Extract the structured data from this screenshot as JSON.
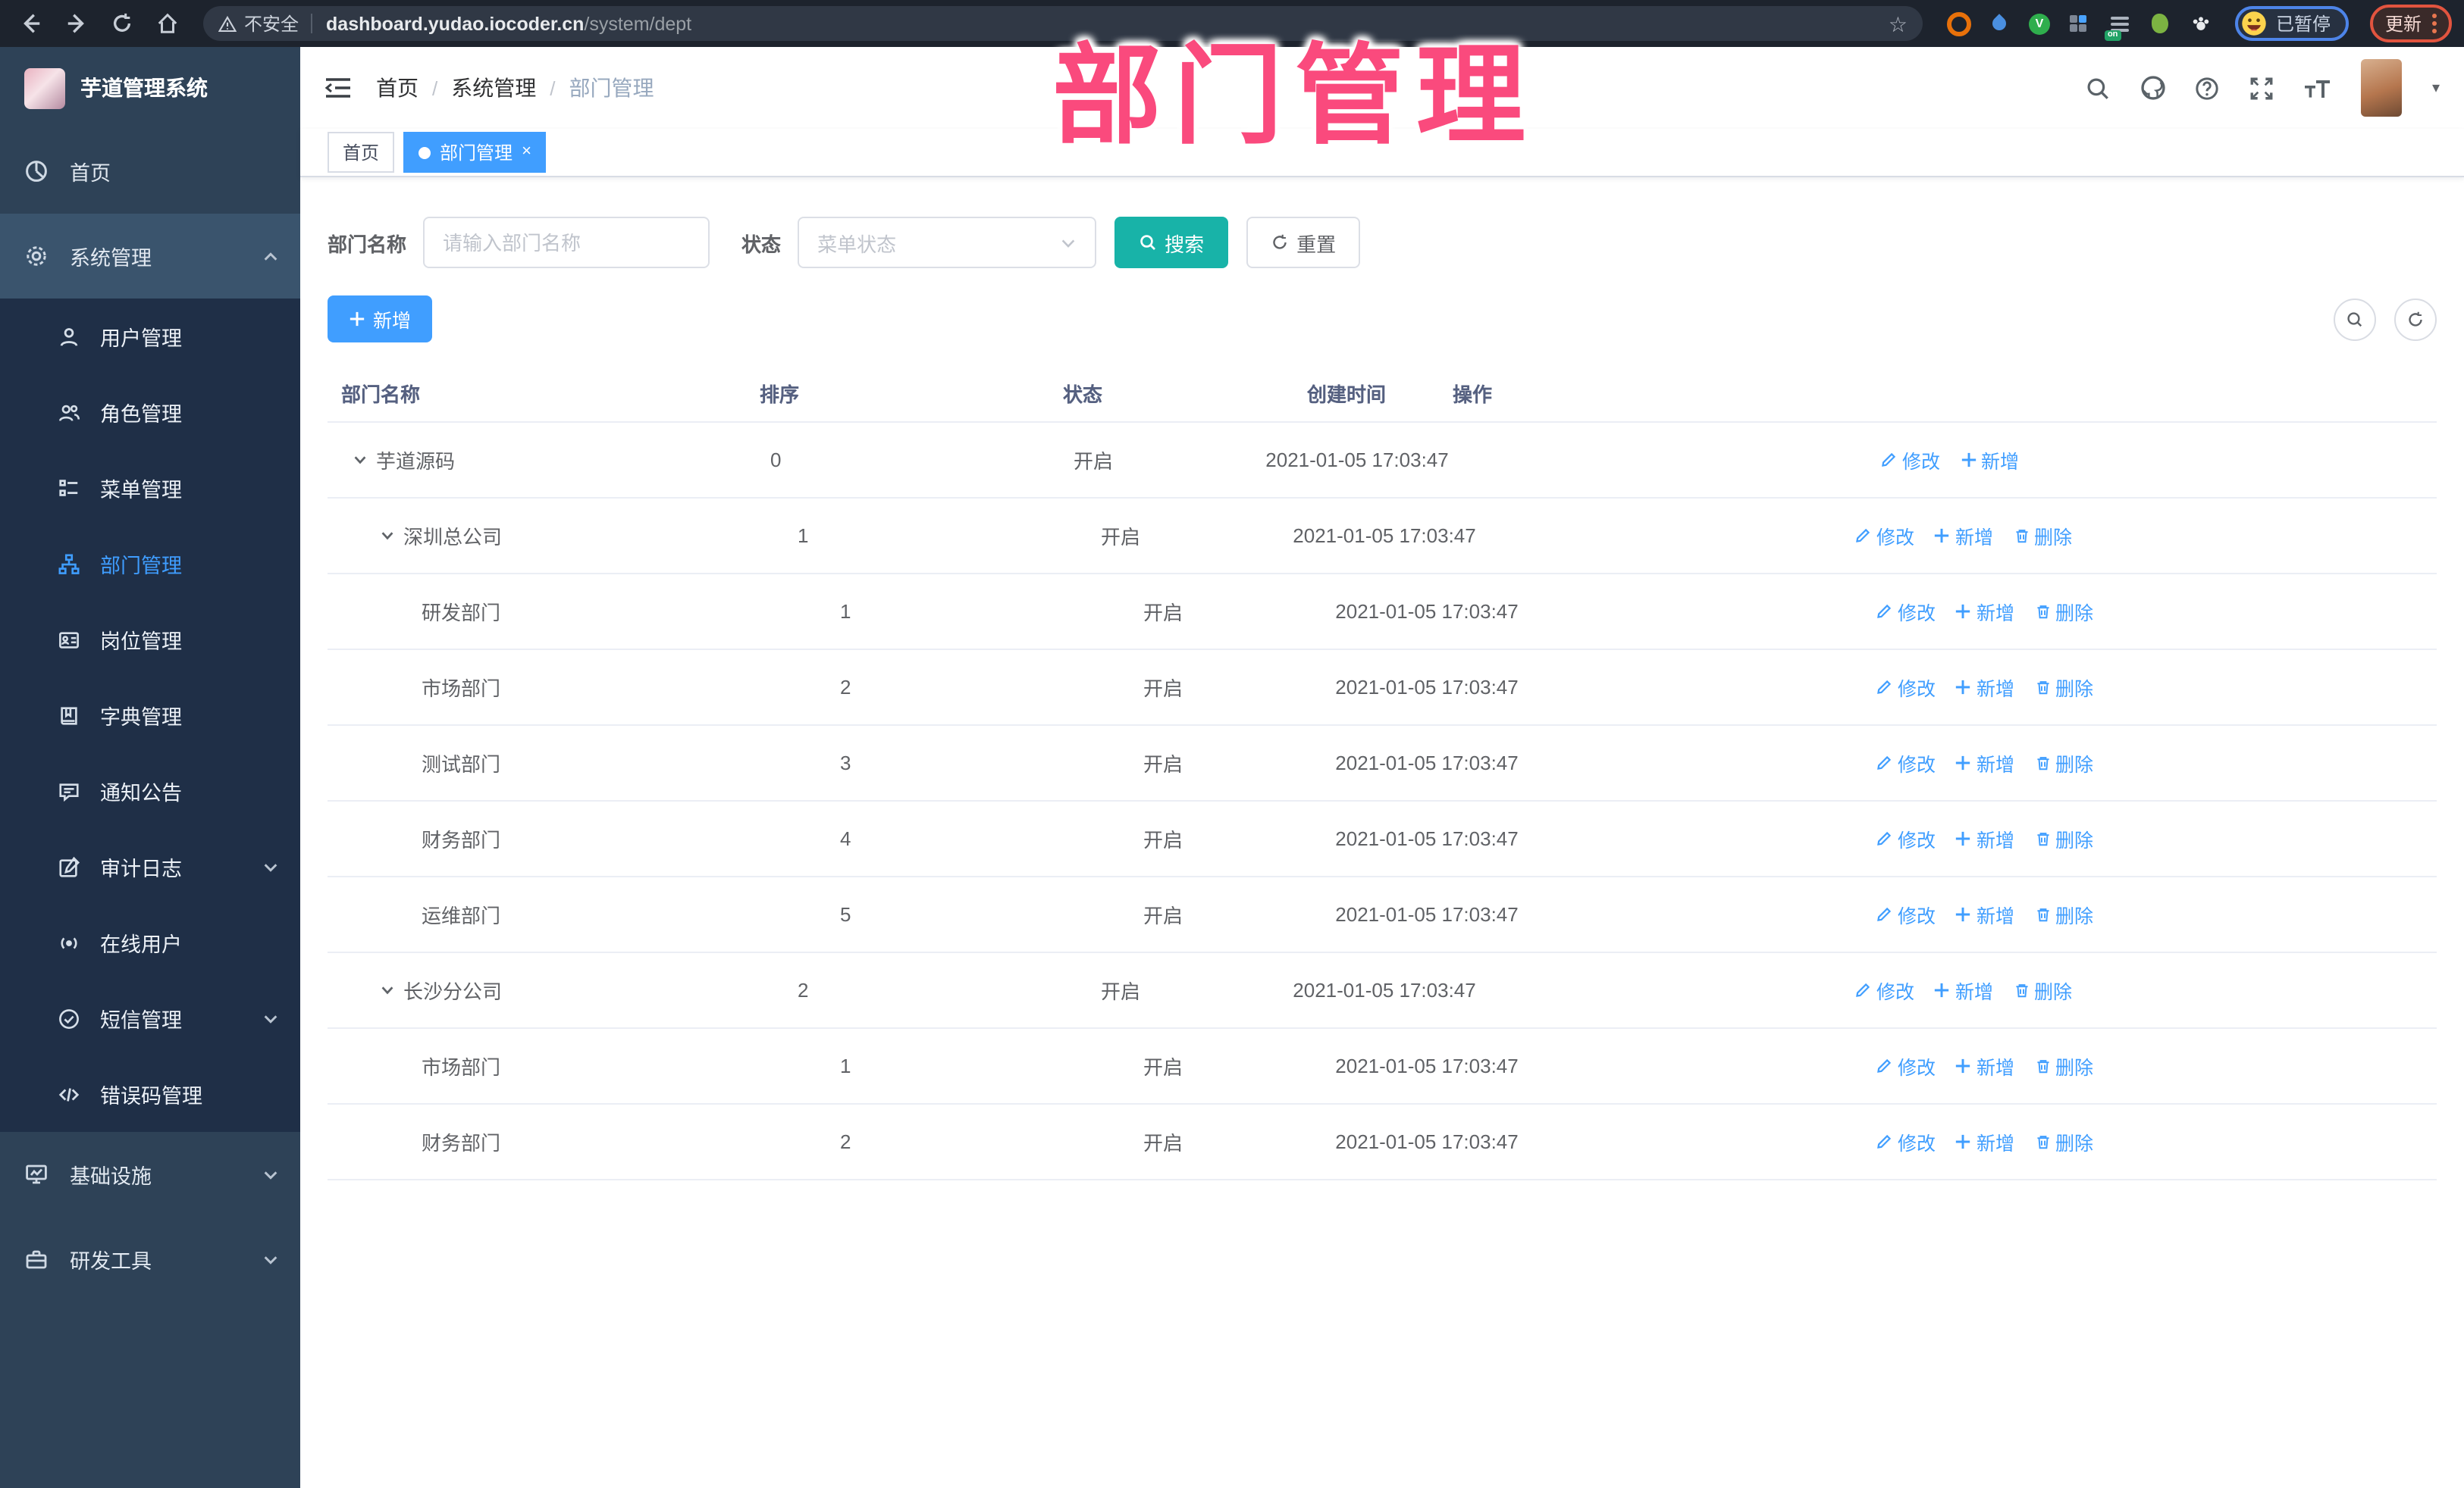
{
  "overlay_title": "部门管理",
  "browser": {
    "security_label": "不安全",
    "url_domain": "dashboard.yudao.iocoder.cn",
    "url_path": "/system/dept",
    "extension_badge": "on",
    "extension_v": "V",
    "profile_status": "已暂停",
    "update_label": "更新"
  },
  "sidebar": {
    "app_title": "芋道管理系统",
    "home": "首页",
    "system": "系统管理",
    "sub": [
      "用户管理",
      "角色管理",
      "菜单管理",
      "部门管理",
      "岗位管理",
      "字典管理",
      "通知公告",
      "审计日志",
      "在线用户",
      "短信管理",
      "错误码管理"
    ],
    "infra": "基础设施",
    "devtools": "研发工具"
  },
  "navbar": {
    "breadcrumb": [
      "首页",
      "系统管理",
      "部门管理"
    ]
  },
  "tabs": {
    "home": "首页",
    "active": "部门管理"
  },
  "search": {
    "dept_label": "部门名称",
    "dept_placeholder": "请输入部门名称",
    "status_label": "状态",
    "status_placeholder": "菜单状态",
    "search_label": "搜索",
    "reset_label": "重置"
  },
  "toolbar": {
    "add_label": "新增"
  },
  "table": {
    "headers": [
      "部门名称",
      "排序",
      "状态",
      "创建时间",
      "操作"
    ],
    "action_labels": {
      "edit": "修改",
      "add": "新增",
      "delete": "删除"
    },
    "rows": [
      {
        "name": "芋道源码",
        "level": 0,
        "expandable": true,
        "sort": "0",
        "status": "开启",
        "time": "2021-01-05 17:03:47",
        "actions": [
          "edit",
          "add"
        ]
      },
      {
        "name": "深圳总公司",
        "level": 1,
        "expandable": true,
        "sort": "1",
        "status": "开启",
        "time": "2021-01-05 17:03:47",
        "actions": [
          "edit",
          "add",
          "delete"
        ]
      },
      {
        "name": "研发部门",
        "level": 2,
        "expandable": false,
        "sort": "1",
        "status": "开启",
        "time": "2021-01-05 17:03:47",
        "actions": [
          "edit",
          "add",
          "delete"
        ]
      },
      {
        "name": "市场部门",
        "level": 2,
        "expandable": false,
        "sort": "2",
        "status": "开启",
        "time": "2021-01-05 17:03:47",
        "actions": [
          "edit",
          "add",
          "delete"
        ]
      },
      {
        "name": "测试部门",
        "level": 2,
        "expandable": false,
        "sort": "3",
        "status": "开启",
        "time": "2021-01-05 17:03:47",
        "actions": [
          "edit",
          "add",
          "delete"
        ]
      },
      {
        "name": "财务部门",
        "level": 2,
        "expandable": false,
        "sort": "4",
        "status": "开启",
        "time": "2021-01-05 17:03:47",
        "actions": [
          "edit",
          "add",
          "delete"
        ]
      },
      {
        "name": "运维部门",
        "level": 2,
        "expandable": false,
        "sort": "5",
        "status": "开启",
        "time": "2021-01-05 17:03:47",
        "actions": [
          "edit",
          "add",
          "delete"
        ]
      },
      {
        "name": "长沙分公司",
        "level": 1,
        "expandable": true,
        "sort": "2",
        "status": "开启",
        "time": "2021-01-05 17:03:47",
        "actions": [
          "edit",
          "add",
          "delete"
        ]
      },
      {
        "name": "市场部门",
        "level": 2,
        "expandable": false,
        "sort": "1",
        "status": "开启",
        "time": "2021-01-05 17:03:47",
        "actions": [
          "edit",
          "add",
          "delete"
        ]
      },
      {
        "name": "财务部门",
        "level": 2,
        "expandable": false,
        "sort": "2",
        "status": "开启",
        "time": "2021-01-05 17:03:47",
        "actions": [
          "edit",
          "add",
          "delete"
        ]
      }
    ]
  },
  "colors": {
    "accent_blue": "#409eff",
    "search_teal": "#18b3a8",
    "annotation_pink": "#fa4a7d"
  }
}
